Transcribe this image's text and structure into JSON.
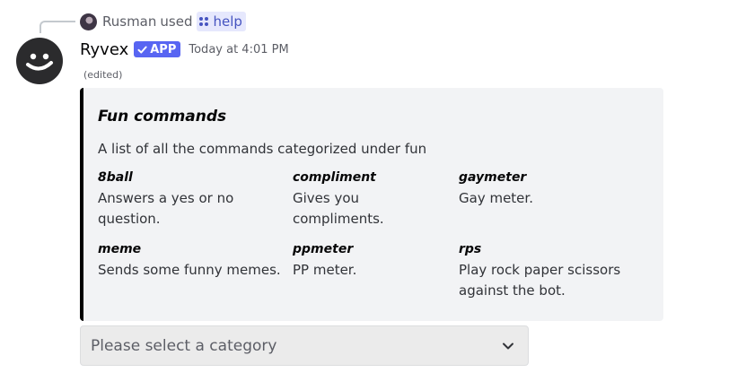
{
  "reply": {
    "user": "Rusman",
    "action": "used",
    "command": "help",
    "command_icon": "slash-command-icon"
  },
  "message": {
    "author": "Ryvex",
    "app_tag": "APP",
    "timestamp": "Today at 4:01 PM",
    "edited": "(edited)",
    "avatar_icon": "smiley-face-icon"
  },
  "embed": {
    "accent_color": "#000000",
    "title": "Fun commands",
    "description": "A list of all the commands categorized under fun",
    "fields": [
      {
        "name": "8ball",
        "value": "Answers a yes or no question."
      },
      {
        "name": "compliment",
        "value": "Gives you compliments."
      },
      {
        "name": "gaymeter",
        "value": "Gay meter."
      },
      {
        "name": "meme",
        "value": "Sends some funny memes."
      },
      {
        "name": "ppmeter",
        "value": "PP meter."
      },
      {
        "name": "rps",
        "value": "Play rock paper scissors against the bot."
      }
    ]
  },
  "select": {
    "placeholder": "Please select a category",
    "icon": "chevron-down-icon"
  },
  "colors": {
    "brand": "#5865f2",
    "mention_bg": "#e6e8fd",
    "mention_text": "#4654c0",
    "embed_bg": "#f2f3f5"
  }
}
